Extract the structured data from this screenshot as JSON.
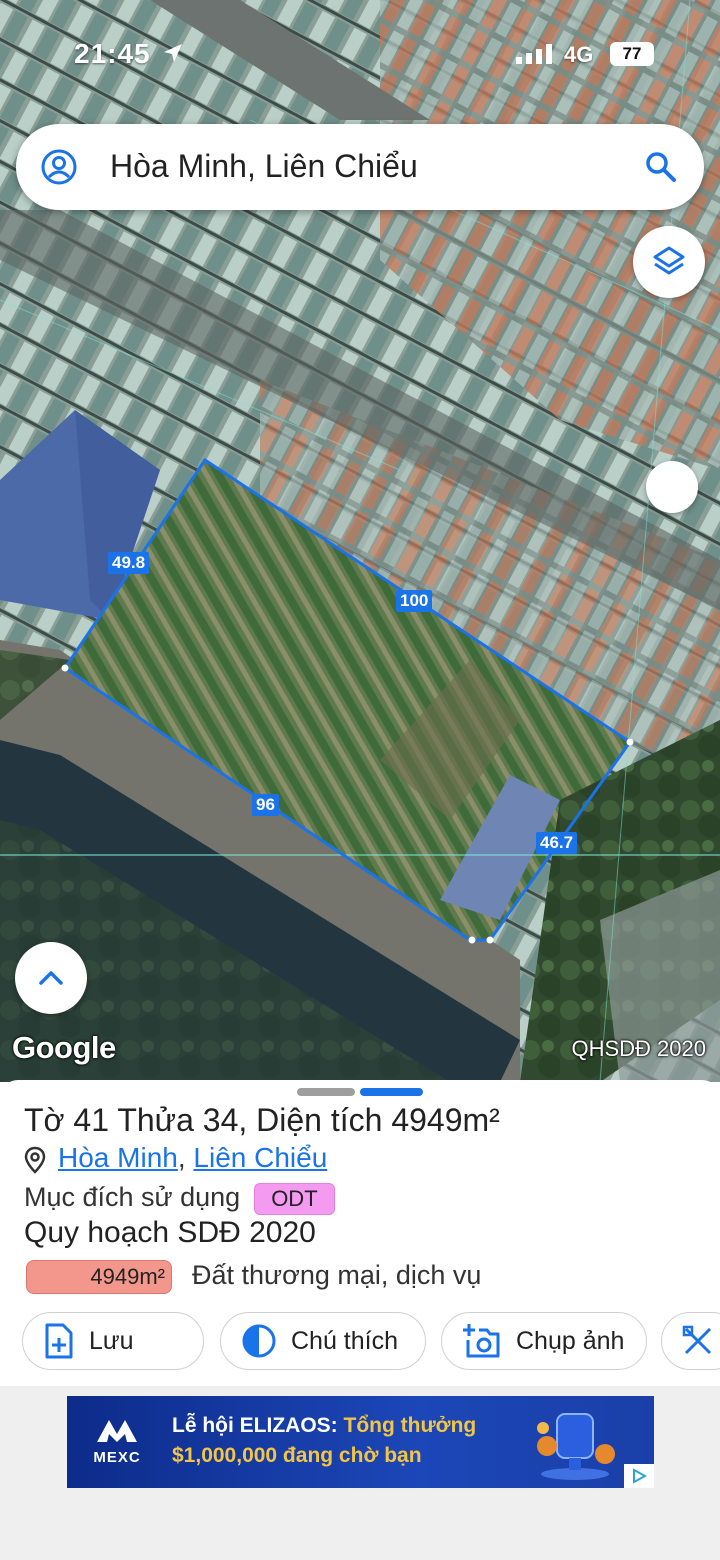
{
  "status_bar": {
    "time": "21:45",
    "network": "4G",
    "battery": "77"
  },
  "search": {
    "query": "Hòa Minh, Liên Chiểu"
  },
  "map": {
    "google_logo": "Google",
    "layer_source": "QHSDĐ 2020",
    "parcel_dimensions": {
      "northwest_edge": "49.8",
      "northeast_edge": "100",
      "southwest_edge": "96",
      "southeast_edge": "46.7"
    },
    "parcel_outline_color": "#1a73e8"
  },
  "parcel": {
    "title": "Tờ 41 Thửa 34, Diện tích 4949m²",
    "ward": "Hòa Minh",
    "separator": ", ",
    "district": "Liên Chiểu",
    "purpose_label": "Mục đích sử dụng",
    "purpose_code": "ODT",
    "purpose_color": "#f49af0",
    "plan_title": "Quy hoạch SDĐ 2020",
    "plan_area": "4949m²",
    "plan_area_color": "#f3978d",
    "plan_use": "Đất thương mại, dịch vụ"
  },
  "actions": [
    {
      "label": "Lưu",
      "icon": "add-document-icon"
    },
    {
      "label": "Chú thích",
      "icon": "contrast-icon"
    },
    {
      "label": "Chụp ảnh",
      "icon": "add-photo-icon"
    },
    {
      "label": "",
      "icon": "ruler-pencil-icon"
    }
  ],
  "ad": {
    "brand": "MEXC",
    "headline_prefix": "Lễ hội ELIZAOS:",
    "headline_highlight": " Tổng thưởng",
    "subline": "$1,000,000 đang chờ bạn"
  }
}
